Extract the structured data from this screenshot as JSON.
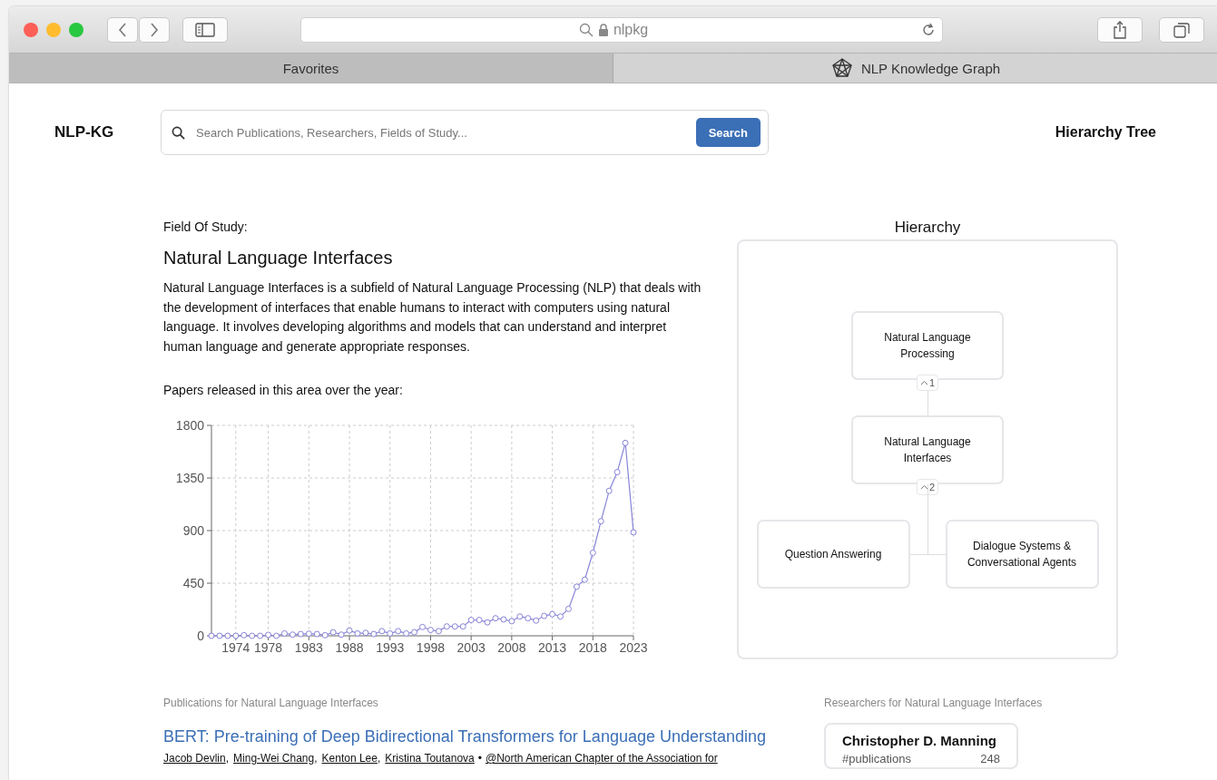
{
  "browser": {
    "address": "nlpkg",
    "tabs": [
      {
        "label": "Favorites",
        "kind": "plain",
        "selected": false
      },
      {
        "label": "NLP Knowledge Graph",
        "kind": "site",
        "selected": true
      }
    ]
  },
  "header": {
    "logo": "NLP-KG",
    "search": {
      "placeholder": "Search Publications, Researchers, Fields of Study...",
      "button": "Search"
    },
    "nav_link": "Hierarchy Tree"
  },
  "field": {
    "caption": "Field Of Study:",
    "title": "Natural Language Interfaces",
    "description": "Natural Language Interfaces is a subfield of Natural Language Processing (NLP) that deals with the development of interfaces that enable humans to interact with computers using natural language. It involves developing algorithms and models that can understand and interpret human language and generate appropriate responses.",
    "chart_caption": "Papers released in this area over the year:",
    "chart_data": {
      "type": "line",
      "x": [
        1971,
        1972,
        1973,
        1974,
        1975,
        1976,
        1977,
        1978,
        1979,
        1980,
        1981,
        1982,
        1983,
        1984,
        1985,
        1986,
        1987,
        1988,
        1989,
        1990,
        1991,
        1992,
        1993,
        1994,
        1995,
        1996,
        1997,
        1998,
        1999,
        2000,
        2001,
        2002,
        2003,
        2004,
        2005,
        2006,
        2007,
        2008,
        2009,
        2010,
        2011,
        2012,
        2013,
        2014,
        2015,
        2016,
        2017,
        2018,
        2019,
        2020,
        2021,
        2022,
        2023
      ],
      "grid": true,
      "series": [
        {
          "color": "#8884d8",
          "marker": true,
          "values": [
            0,
            0,
            0,
            0,
            5,
            0,
            0,
            8,
            0,
            20,
            10,
            15,
            18,
            15,
            5,
            30,
            10,
            45,
            20,
            25,
            15,
            40,
            20,
            40,
            20,
            30,
            75,
            50,
            40,
            80,
            80,
            80,
            135,
            135,
            115,
            150,
            140,
            125,
            165,
            150,
            130,
            170,
            185,
            165,
            230,
            420,
            480,
            710,
            980,
            1240,
            1400,
            1650,
            885
          ]
        }
      ],
      "xlim": [
        1971,
        2023
      ],
      "ylim": [
        0,
        1800
      ],
      "xticks": [
        1974,
        1978,
        1983,
        1988,
        1993,
        1998,
        2003,
        2008,
        2013,
        2018,
        2023
      ],
      "yticks": [
        0,
        450,
        900,
        1350,
        1800
      ]
    }
  },
  "hierarchy": {
    "title": "Hierarchy",
    "root": {
      "label": "Natural Language Processing",
      "badge": "1",
      "children": [
        {
          "label": "Natural Language Interfaces",
          "badge": "2",
          "children": [
            {
              "label": "Question Answering"
            },
            {
              "label": "Dialogue Systems & Conversational Agents"
            }
          ]
        }
      ]
    }
  },
  "publications": {
    "caption": "Publications for Natural Language Interfaces",
    "items": [
      {
        "title": "BERT: Pre-training of Deep Bidirectional Transformers for Language Understanding",
        "authors": [
          "Jacob Devlin",
          "Ming-Wei Chang",
          "Kenton Lee",
          "Kristina Toutanova"
        ],
        "author_separator": ",",
        "venue_separator": "•",
        "venue": "@North American Chapter of the Association for"
      }
    ]
  },
  "researchers": {
    "caption": "Researchers for Natural Language Interfaces",
    "items": [
      {
        "name": "Christopher D. Manning",
        "stat_label": "#publications",
        "stat_value": "248"
      }
    ]
  }
}
